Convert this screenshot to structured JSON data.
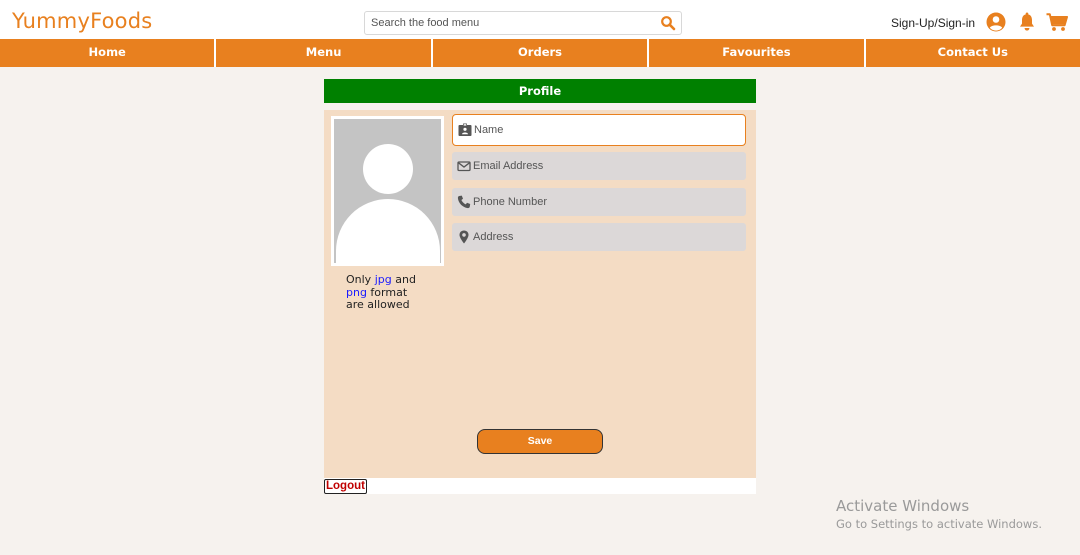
{
  "header": {
    "logo": "YummyFoods",
    "search_placeholder": "Search the food menu",
    "signin_label": "Sign-Up/Sign-in"
  },
  "icons": {
    "search": "search-icon",
    "user": "user-circle-icon",
    "bell": "bell-icon",
    "cart": "cart-icon"
  },
  "nav": {
    "items": [
      "Home",
      "Menu",
      "Orders",
      "Favourites",
      "Contact Us"
    ]
  },
  "profile": {
    "title": "Profile",
    "fields": {
      "name": "Name",
      "email": "Email Address",
      "phone": "Phone Number",
      "address": "Address"
    },
    "note": {
      "line1_a": "Only ",
      "line1_hl": "jpg",
      "line1_b": " and",
      "line2_hl": "png",
      "line2_b": " format",
      "line3": "are allowed"
    },
    "save_label": "Save",
    "logout_label": "Logout"
  },
  "watermark": {
    "title": "Activate Windows",
    "subtitle": "Go to Settings to activate Windows."
  },
  "colors": {
    "brand": "#e8801f",
    "profile_header": "#008000",
    "panel": "#f4dcc4",
    "logout": "#c00000"
  }
}
